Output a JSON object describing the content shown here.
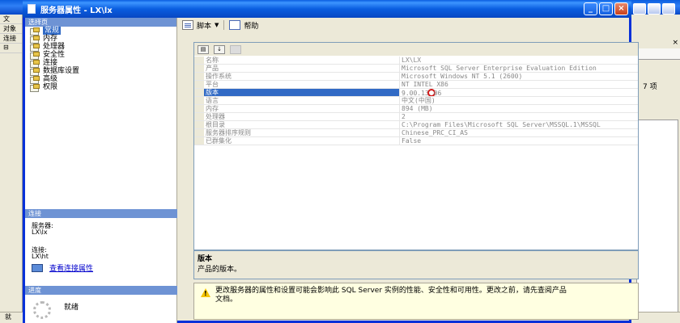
{
  "background": {
    "left_rows": [
      "文",
      "对象",
      "连接",
      "⊟"
    ],
    "status_left": "就"
  },
  "dialog": {
    "title": "服务器属性 - LX\\lx",
    "controls": [
      "_",
      "□",
      "×"
    ]
  },
  "select_page": {
    "header": "选择页",
    "items": [
      {
        "label": "常规",
        "selected": true
      },
      {
        "label": "内存"
      },
      {
        "label": "处理器"
      },
      {
        "label": "安全性"
      },
      {
        "label": "连接"
      },
      {
        "label": "数据库设置"
      },
      {
        "label": "高级"
      },
      {
        "label": "权限"
      }
    ]
  },
  "connection": {
    "header": "连接",
    "server_label": "服务器:",
    "server_value": "LX\\lx",
    "conn_label": "连接:",
    "conn_value": "LX\\ht",
    "view_link": "查看连接属性"
  },
  "progress": {
    "header": "进度",
    "status": "就绪"
  },
  "toolbar": {
    "script": "脚本",
    "help": "帮助"
  },
  "properties": [
    {
      "name": "名称",
      "value": "LX\\LX"
    },
    {
      "name": "产品",
      "value": "Microsoft SQL Server Enterprise Evaluation Edition"
    },
    {
      "name": "操作系统",
      "value": "Microsoft Windows NT 5.1 (2600)"
    },
    {
      "name": "平台",
      "value": "NT INTEL X86"
    },
    {
      "name": "版本",
      "value": "9.00.13",
      "value2": "06",
      "selected": true
    },
    {
      "name": "语言",
      "value": "中文(中国)"
    },
    {
      "name": "内存",
      "value": "894 (MB)"
    },
    {
      "name": "处理器",
      "value": "2"
    },
    {
      "name": "根目录",
      "value": "C:\\Program Files\\Microsoft SQL Server\\MSSQL.1\\MSSQL"
    },
    {
      "name": "服务器排序规则",
      "value": "Chinese_PRC_CI_AS"
    },
    {
      "name": "已群集化",
      "value": "False"
    }
  ],
  "description": {
    "title": "版本",
    "text": "产品的版本。"
  },
  "warning": {
    "line1": "更改服务器的属性和设置可能会影响此 SQL Server 实例的性能、安全性和可用性。更改之前，请先查阅产品",
    "line2": "文档。"
  },
  "right_fragment": {
    "close": "×",
    "count": "7 项"
  }
}
